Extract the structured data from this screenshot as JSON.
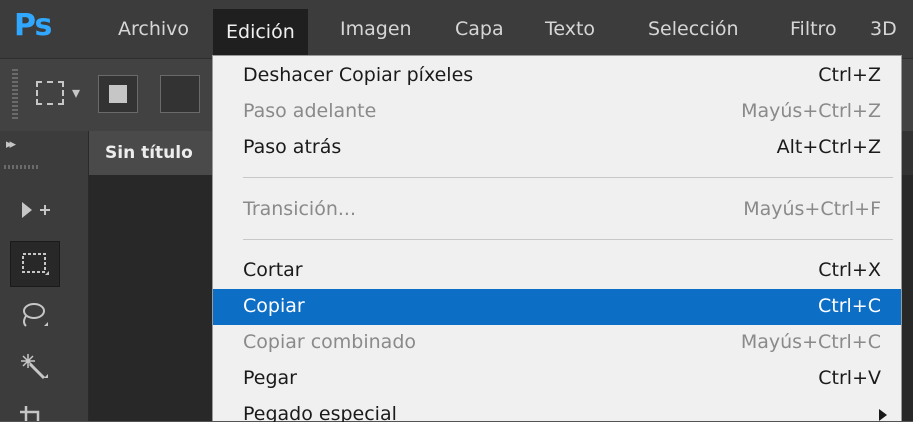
{
  "app": {
    "logo": "Ps"
  },
  "menubar": {
    "items": [
      "Archivo",
      "Edición",
      "Imagen",
      "Capa",
      "Texto",
      "Selección",
      "Filtro",
      "3D"
    ]
  },
  "document": {
    "tab_title": "Sin título"
  },
  "tools": [
    "move-tool-icon",
    "marquee-tool-icon",
    "lasso-tool-icon",
    "magic-wand-tool-icon",
    "crop-tool-icon"
  ],
  "edit_menu": {
    "items": [
      {
        "label": "Deshacer Copiar píxeles",
        "shortcut": "Ctrl+Z",
        "enabled": true
      },
      {
        "label": "Paso adelante",
        "shortcut": "Mayús+Ctrl+Z",
        "enabled": false
      },
      {
        "label": "Paso atrás",
        "shortcut": "Alt+Ctrl+Z",
        "enabled": true
      },
      {
        "label": "Transición...",
        "shortcut": "Mayús+Ctrl+F",
        "enabled": false
      },
      {
        "label": "Cortar",
        "shortcut": "Ctrl+X",
        "enabled": true
      },
      {
        "label": "Copiar",
        "shortcut": "Ctrl+C",
        "enabled": true,
        "highlighted": true
      },
      {
        "label": "Copiar combinado",
        "shortcut": "Mayús+Ctrl+C",
        "enabled": false
      },
      {
        "label": "Pegar",
        "shortcut": "Ctrl+V",
        "enabled": true
      },
      {
        "label": "Pegado especial",
        "shortcut": "",
        "enabled": true,
        "submenu": true
      }
    ]
  },
  "colors": {
    "highlight": "#0d6ec6",
    "menubar": "#3c3c3c",
    "menu_bg": "#f0f0f0",
    "logo": "#31a8ff"
  }
}
